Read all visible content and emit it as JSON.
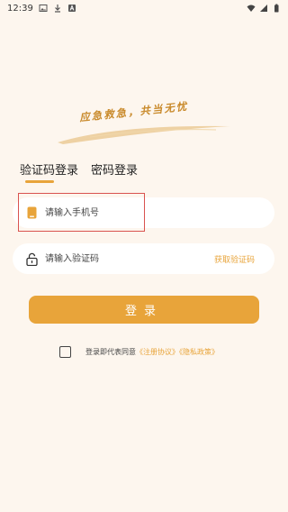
{
  "status": {
    "time": "12:39"
  },
  "slogan": "应急救急，共当无忧",
  "tabs": [
    {
      "label": "验证码登录",
      "active": true
    },
    {
      "label": "密码登录",
      "active": false
    }
  ],
  "phone": {
    "placeholder": "请输入手机号",
    "icon": "phone-icon"
  },
  "code": {
    "placeholder": "请输入验证码",
    "icon": "lock-icon",
    "get_code": "获取验证码"
  },
  "login_label": "登录",
  "agreement": {
    "prefix": "登录即代表同意",
    "terms": "《注册协议》",
    "privacy": "《隐私政策》"
  },
  "colors": {
    "accent": "#e8a43a",
    "background": "#fdf6ee",
    "highlight": "#d9534f"
  }
}
